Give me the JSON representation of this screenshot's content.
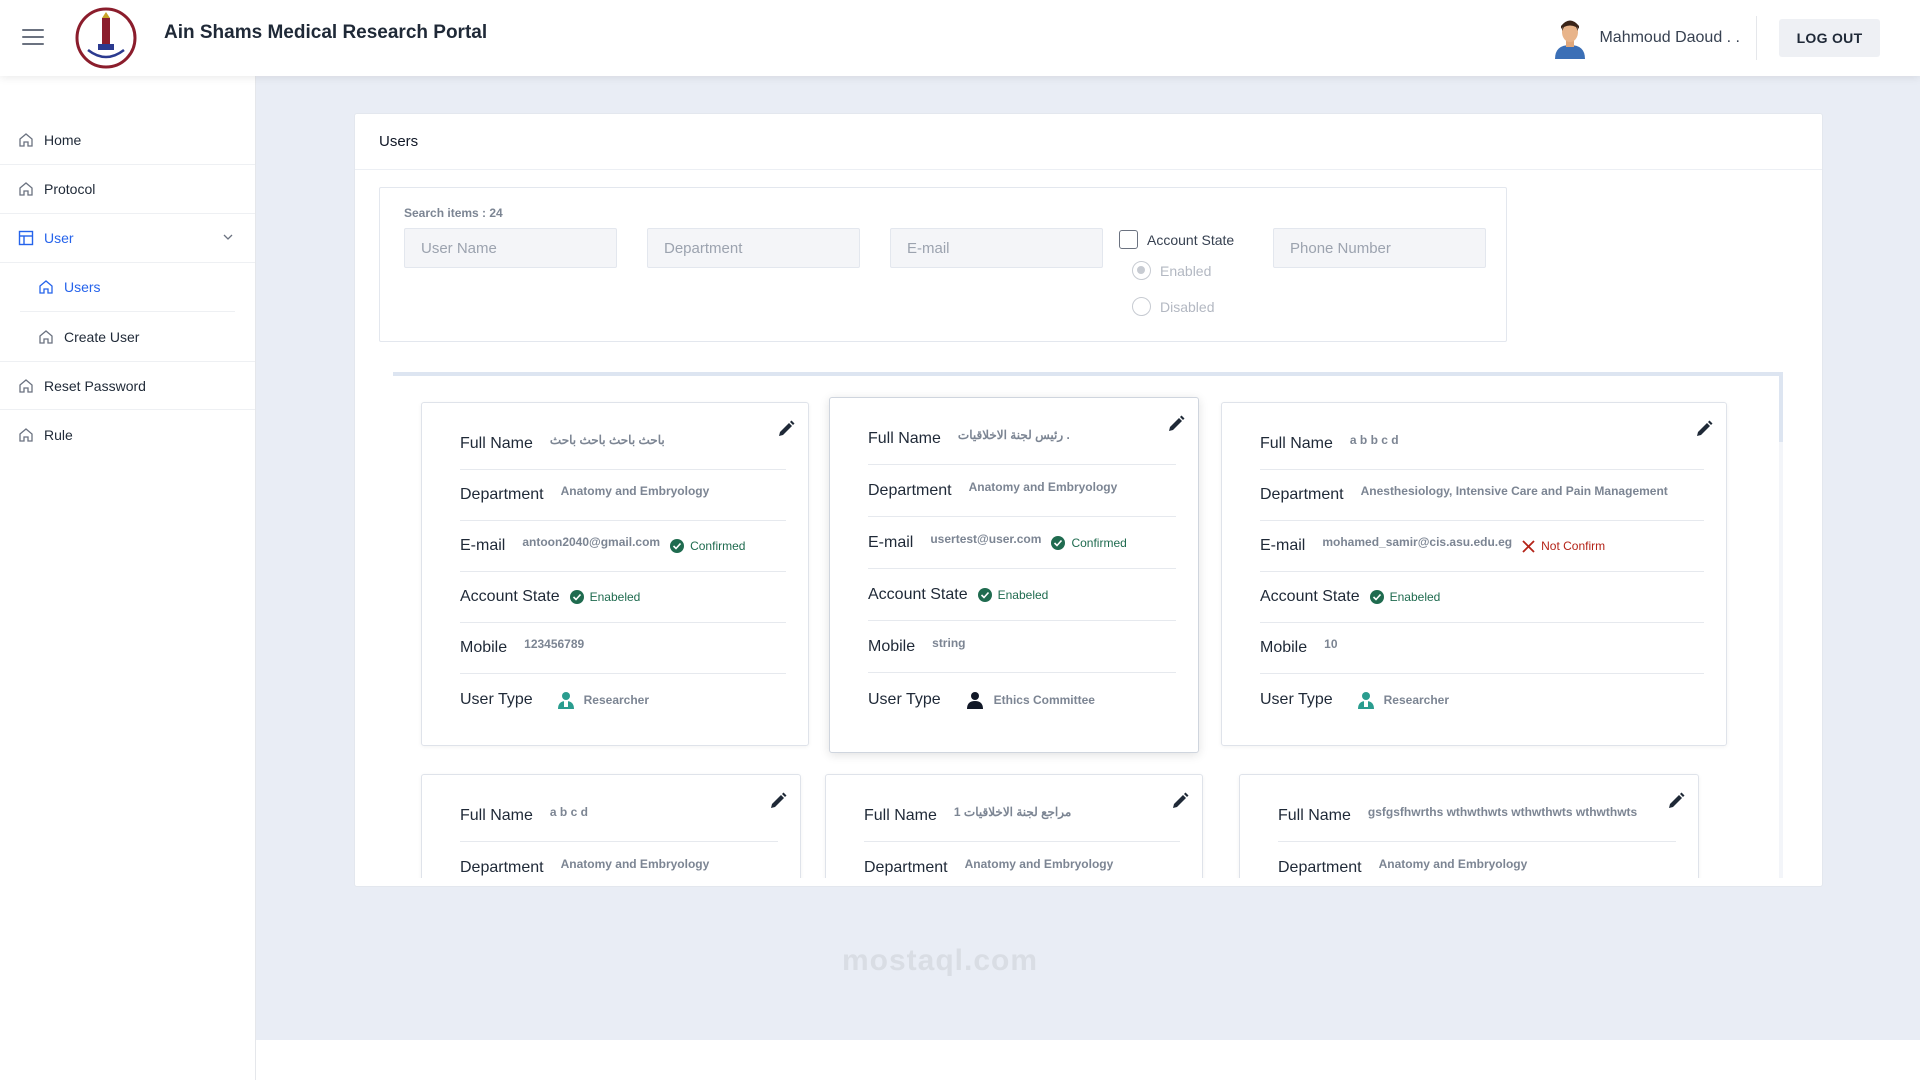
{
  "header": {
    "title": "Ain Shams Medical Research Portal",
    "user_name": "Mahmoud Daoud . .",
    "logout_label": "LOG OUT"
  },
  "sidebar": {
    "items": [
      {
        "label": "Home"
      },
      {
        "label": "Protocol"
      },
      {
        "label": "User"
      },
      {
        "label": "Users"
      },
      {
        "label": "Create User"
      },
      {
        "label": "Reset Password"
      },
      {
        "label": "Rule"
      }
    ]
  },
  "page": {
    "title": "Users",
    "search_count": "Search items : 24",
    "filters": {
      "user_name_placeholder": "User Name",
      "department_placeholder": "Department",
      "email_placeholder": "E-mail",
      "phone_placeholder": "Phone Number",
      "account_state_label": "Account State",
      "enabled_label": "Enabled",
      "disabled_label": "Disabled"
    }
  },
  "field_labels": {
    "full_name": "Full Name",
    "department": "Department",
    "email": "E-mail",
    "account_state": "Account State",
    "mobile": "Mobile",
    "user_type": "User Type"
  },
  "cards": [
    {
      "full_name": "باحث باحث باحث باحث",
      "department": "Anatomy and Embryology",
      "email": "antoon2040@gmail.com",
      "email_status": "Confirmed",
      "account_state": "Enabeled",
      "mobile": "123456789",
      "user_type": "Researcher"
    },
    {
      "full_name": "رئيس لجنة الاخلاقيات .",
      "department": "Anatomy and Embryology",
      "email": "usertest@user.com",
      "email_status": "Confirmed",
      "account_state": "Enabeled",
      "mobile": "string",
      "user_type": "Ethics Committee"
    },
    {
      "full_name": "a b b c d",
      "department": "Anesthesiology, Intensive Care and Pain Management",
      "email": "mohamed_samir@cis.asu.edu.eg",
      "email_status": "Not Confirm",
      "account_state": "Enabeled",
      "mobile": "10",
      "user_type": "Researcher"
    },
    {
      "full_name": "a b c d",
      "department": "Anatomy and Embryology"
    },
    {
      "full_name": "مراجع لجنة الاخلاقيات 1",
      "department": "Anatomy and Embryology"
    },
    {
      "full_name": "gsfgsfhwrths wthwthwts wthwthwts wthwthwts",
      "department": "Anatomy and Embryology"
    }
  ],
  "colors": {
    "accent": "#2563eb",
    "confirmed": "#1f6b4f",
    "not_confirmed": "#b42318",
    "researcher_icon": "#2a9d8f"
  },
  "watermark": "mostaql.com"
}
